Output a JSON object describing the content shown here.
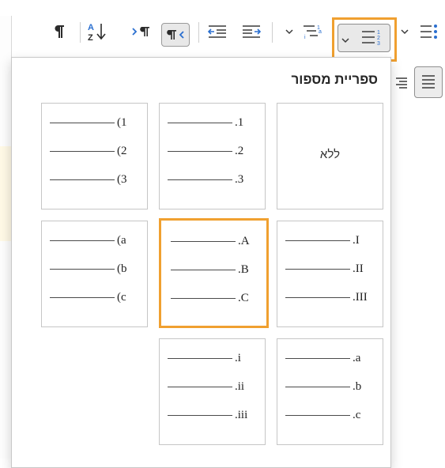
{
  "dropdown": {
    "title": "ספריית מספור",
    "tiles": [
      {
        "name": "numbering-none",
        "label": "ללא",
        "markers": []
      },
      {
        "name": "numbering-arabic-dot",
        "markers": [
          ".1",
          ".2",
          ".3"
        ]
      },
      {
        "name": "numbering-arabic-paren",
        "markers": [
          "(1",
          "(2",
          "(3"
        ]
      },
      {
        "name": "numbering-roman-upper",
        "markers": [
          ".I",
          ".II",
          ".III"
        ]
      },
      {
        "name": "numbering-alpha-upper",
        "markers": [
          ".A",
          ".B",
          ".C"
        ],
        "selected": true
      },
      {
        "name": "numbering-alpha-lower-paren",
        "markers": [
          "(a",
          "(b",
          "(c"
        ]
      },
      {
        "name": "numbering-alpha-lower",
        "markers": [
          ".a",
          ".b",
          ".c"
        ]
      },
      {
        "name": "numbering-roman-lower",
        "markers": [
          ".i",
          ".ii",
          ".iii"
        ]
      }
    ]
  },
  "toolbar": {
    "icons": [
      "paragraph-mark-icon",
      "sort-az-icon",
      "ltr-direction-icon",
      "rtl-direction-icon",
      "decrease-indent-icon",
      "increase-indent-icon",
      "multilevel-list-icon",
      "numbering-icon",
      "bullets-icon"
    ]
  },
  "colors": {
    "highlight": "#f0a030",
    "border": "#c6c6c6",
    "text": "#262626"
  }
}
